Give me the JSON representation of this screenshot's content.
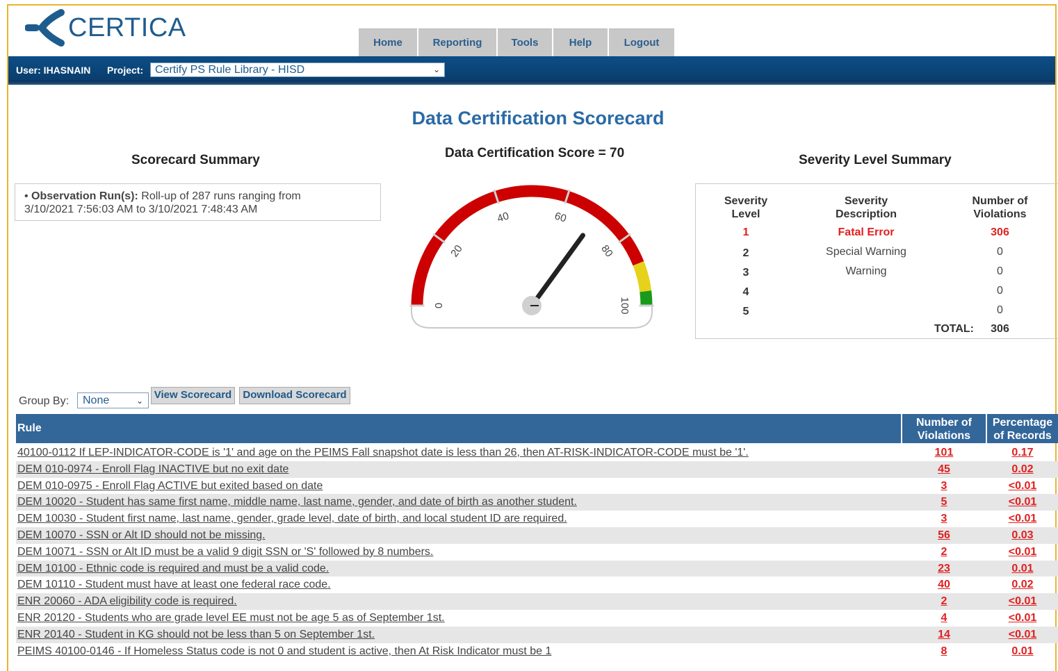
{
  "app": {
    "logo_text": "CERTICA",
    "nav_tabs": [
      "Home",
      "Reporting",
      "Tools",
      "Help",
      "Logout"
    ],
    "user_label": "User: IHASNAIN",
    "project_label": "Project:",
    "project_value": "Certify PS Rule Library - HISD"
  },
  "page": {
    "title": "Data Certification Scorecard",
    "summary_title": "Scorecard Summary",
    "summary_label": "Observation Run(s):",
    "summary_line1": " Roll-up of 287 runs ranging from",
    "summary_line2": "3/10/2021 7:56:03 AM to 3/10/2021 7:48:43 AM",
    "score_title": "Data Certification Score = 70",
    "score_value": 70,
    "gauge_ticks": [
      "0",
      "20",
      "40",
      "60",
      "80",
      "100"
    ],
    "severity_title": "Severity Level Summary"
  },
  "severity": {
    "headers": {
      "level": [
        "Severity",
        "Level"
      ],
      "description": [
        "Severity",
        "Description"
      ],
      "violations": [
        "Number of",
        "Violations"
      ]
    },
    "rows": [
      {
        "level": "1",
        "description": "Fatal Error",
        "violations": "306"
      },
      {
        "level": "2",
        "description": "Special Warning",
        "violations": "0"
      },
      {
        "level": "3",
        "description": "Warning",
        "violations": "0"
      },
      {
        "level": "4",
        "description": "",
        "violations": "0"
      },
      {
        "level": "5",
        "description": "",
        "violations": "0"
      }
    ],
    "total_label": "TOTAL:",
    "total_value": "306"
  },
  "controls": {
    "group_by_label": "Group By:",
    "group_by_value": "None",
    "view_button": "View Scorecard",
    "download_button": "Download Scorecard"
  },
  "table": {
    "headers": {
      "rule": "Rule",
      "violations": [
        "Number of",
        "Violations"
      ],
      "percentage": [
        "Percentage",
        "of Records"
      ]
    },
    "rows": [
      {
        "rule": "40100-0112 If LEP-INDICATOR-CODE is '1' and age on the PEIMS Fall snapshot date is less than 26, then AT-RISK-INDICATOR-CODE must be '1'.",
        "violations": "101",
        "percentage": "0.17"
      },
      {
        "rule": "DEM 010-0974 - Enroll Flag INACTIVE but no exit date",
        "violations": "45",
        "percentage": "0.02"
      },
      {
        "rule": "DEM 010-0975 - Enroll Flag ACTIVE but exited based on date",
        "violations": "3",
        "percentage": "<0.01"
      },
      {
        "rule": "DEM 10020 - Student has same first name, middle name, last name, gender, and date of birth as another student.",
        "violations": "5",
        "percentage": "<0.01"
      },
      {
        "rule": "DEM 10030 - Student first name, last name, gender, grade level, date of birth, and local student ID are required.",
        "violations": "3",
        "percentage": "<0.01"
      },
      {
        "rule": "DEM 10070 - SSN or Alt ID should not be missing.",
        "violations": "56",
        "percentage": "0.03"
      },
      {
        "rule": "DEM 10071 - SSN or Alt ID must be a valid 9 digit SSN or 'S' followed by 8 numbers.",
        "violations": "2",
        "percentage": "<0.01"
      },
      {
        "rule": "DEM 10100 - Ethnic code is required and must be a valid code.",
        "violations": "23",
        "percentage": "0.01"
      },
      {
        "rule": "DEM 10110 - Student must have at least one federal race code.",
        "violations": "40",
        "percentage": "0.02"
      },
      {
        "rule": "ENR 20060 - ADA eligibility code is required.",
        "violations": "2",
        "percentage": "<0.01"
      },
      {
        "rule": "ENR 20120 - Students who are grade level EE must not be age 5 as of September 1st.",
        "violations": "4",
        "percentage": "<0.01"
      },
      {
        "rule": "ENR 20140 - Student in KG should not be less than 5 on September 1st.",
        "violations": "14",
        "percentage": "<0.01"
      },
      {
        "rule": "PEIMS 40100-0146 - If Homeless Status code is not 0 and student is active, then At Risk Indicator must be 1",
        "violations": "8",
        "percentage": "0.01"
      }
    ]
  },
  "colors": {
    "brand_blue": "#1f5c8e",
    "header_blue": "#336699",
    "fatal_red": "#e02020",
    "gauge_red": "#cc0000",
    "gauge_yellow": "#e6d21a",
    "gauge_green": "#1a9a1a"
  }
}
